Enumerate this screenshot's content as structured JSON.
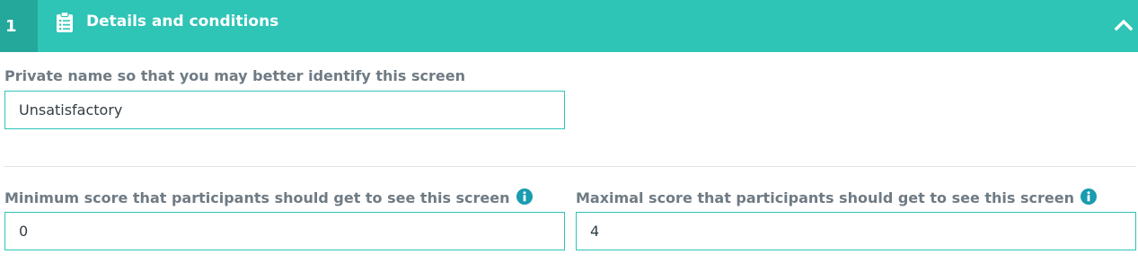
{
  "section": {
    "step_number": "1",
    "title": "Details and conditions",
    "icon": "clipboard-list-icon",
    "toggle_icon": "chevron-up-icon",
    "accent_color": "#2ec4b6",
    "badge_color": "#25a89c"
  },
  "fields": {
    "private_name": {
      "label": "Private name so that you may better identify this screen",
      "value": "Unsatisfactory"
    },
    "min_score": {
      "label": "Minimum score that participants should get to see this screen",
      "value": "0",
      "info_icon": "info-icon"
    },
    "max_score": {
      "label": "Maximal score that participants should get to see this screen",
      "value": "4",
      "info_icon": "info-icon"
    }
  }
}
